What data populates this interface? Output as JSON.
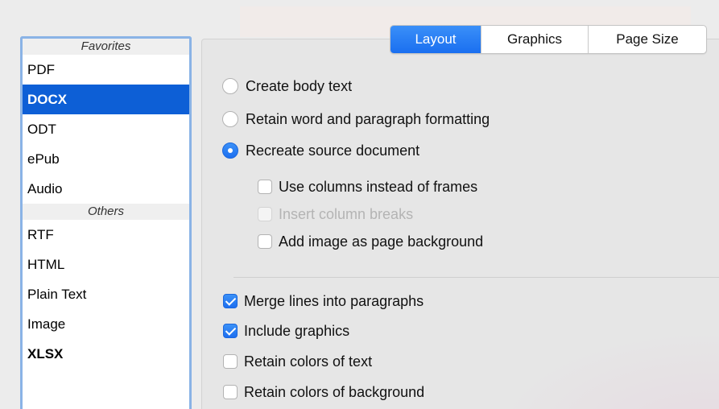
{
  "sidebar": {
    "favorites_header": "Favorites",
    "favorites": [
      {
        "label": "PDF",
        "selected": false
      },
      {
        "label": "DOCX",
        "selected": true
      },
      {
        "label": "ODT",
        "selected": false
      },
      {
        "label": "ePub",
        "selected": false
      },
      {
        "label": "Audio",
        "selected": false
      }
    ],
    "others_header": "Others",
    "others": [
      {
        "label": "RTF"
      },
      {
        "label": "HTML"
      },
      {
        "label": "Plain Text"
      },
      {
        "label": "Image"
      },
      {
        "label": "XLSX"
      }
    ]
  },
  "tabs": [
    {
      "label": "Layout",
      "active": true
    },
    {
      "label": "Graphics",
      "active": false
    },
    {
      "label": "Page Size",
      "active": false
    }
  ],
  "layout_options": {
    "radios": [
      {
        "label": "Create body text",
        "checked": false
      },
      {
        "label": "Retain word and paragraph formatting",
        "checked": false
      },
      {
        "label": "Recreate source document",
        "checked": true
      }
    ],
    "sub_options": [
      {
        "label": "Use columns instead of frames",
        "checked": false,
        "enabled": true
      },
      {
        "label": "Insert column breaks",
        "checked": false,
        "enabled": false
      },
      {
        "label": "Add image as page background",
        "checked": false,
        "enabled": true
      }
    ],
    "checkboxes": [
      {
        "label": "Merge lines into paragraphs",
        "checked": true
      },
      {
        "label": "Include graphics",
        "checked": true
      },
      {
        "label": "Retain colors of text",
        "checked": false
      },
      {
        "label": "Retain colors of background",
        "checked": false
      }
    ]
  },
  "colors": {
    "accent": "#1a6ff0",
    "selection": "#0d5fd6",
    "sidebar_focus_ring": "#8ab3e6"
  }
}
